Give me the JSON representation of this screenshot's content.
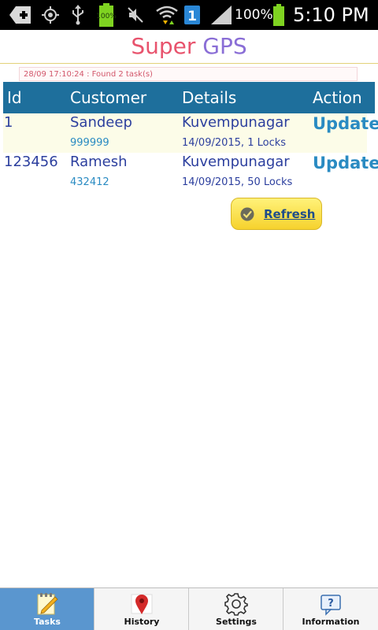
{
  "status_bar": {
    "icons": [
      "add-box-icon",
      "gps-icon",
      "usb-icon",
      "battery-small-icon",
      "mute-icon",
      "wifi-icon",
      "sim-1-icon",
      "signal-icon",
      "battery-icon"
    ],
    "small_battery_label": "100%",
    "battery_percent": "100%",
    "time": "5:10 PM"
  },
  "app": {
    "title_part1": "Super",
    "title_part2": "GPS"
  },
  "log": {
    "text": "28/09 17:10:24 : Found 2 task(s)"
  },
  "table": {
    "headers": [
      "Id",
      "Customer",
      "Details",
      "Action"
    ],
    "rows": [
      {
        "id": "1",
        "customer": "Sandeep",
        "code": "999999",
        "place": "Kuvempunagar",
        "meta": "14/09/2015, 1 Locks",
        "action": "Update"
      },
      {
        "id": "123456",
        "customer": "Ramesh",
        "code": "432412",
        "place": "Kuvempunagar",
        "meta": "14/09/2015, 50 Locks",
        "action": "Update"
      }
    ]
  },
  "refresh": {
    "label": "Refresh",
    "icon": "check-circle-icon"
  },
  "tabs": [
    {
      "label": "Tasks",
      "icon": "notepad-icon",
      "active": true
    },
    {
      "label": "History",
      "icon": "map-pin-icon",
      "active": false
    },
    {
      "label": "Settings",
      "icon": "gear-icon",
      "active": false
    },
    {
      "label": "Information",
      "icon": "help-icon",
      "active": false
    }
  ],
  "colors": {
    "header_bg": "#1e6f9c",
    "title_super": "#e8536d",
    "title_gps": "#8a6ed6",
    "active_tab": "#5a96cf",
    "refresh_yellow": "#f6d22d"
  }
}
